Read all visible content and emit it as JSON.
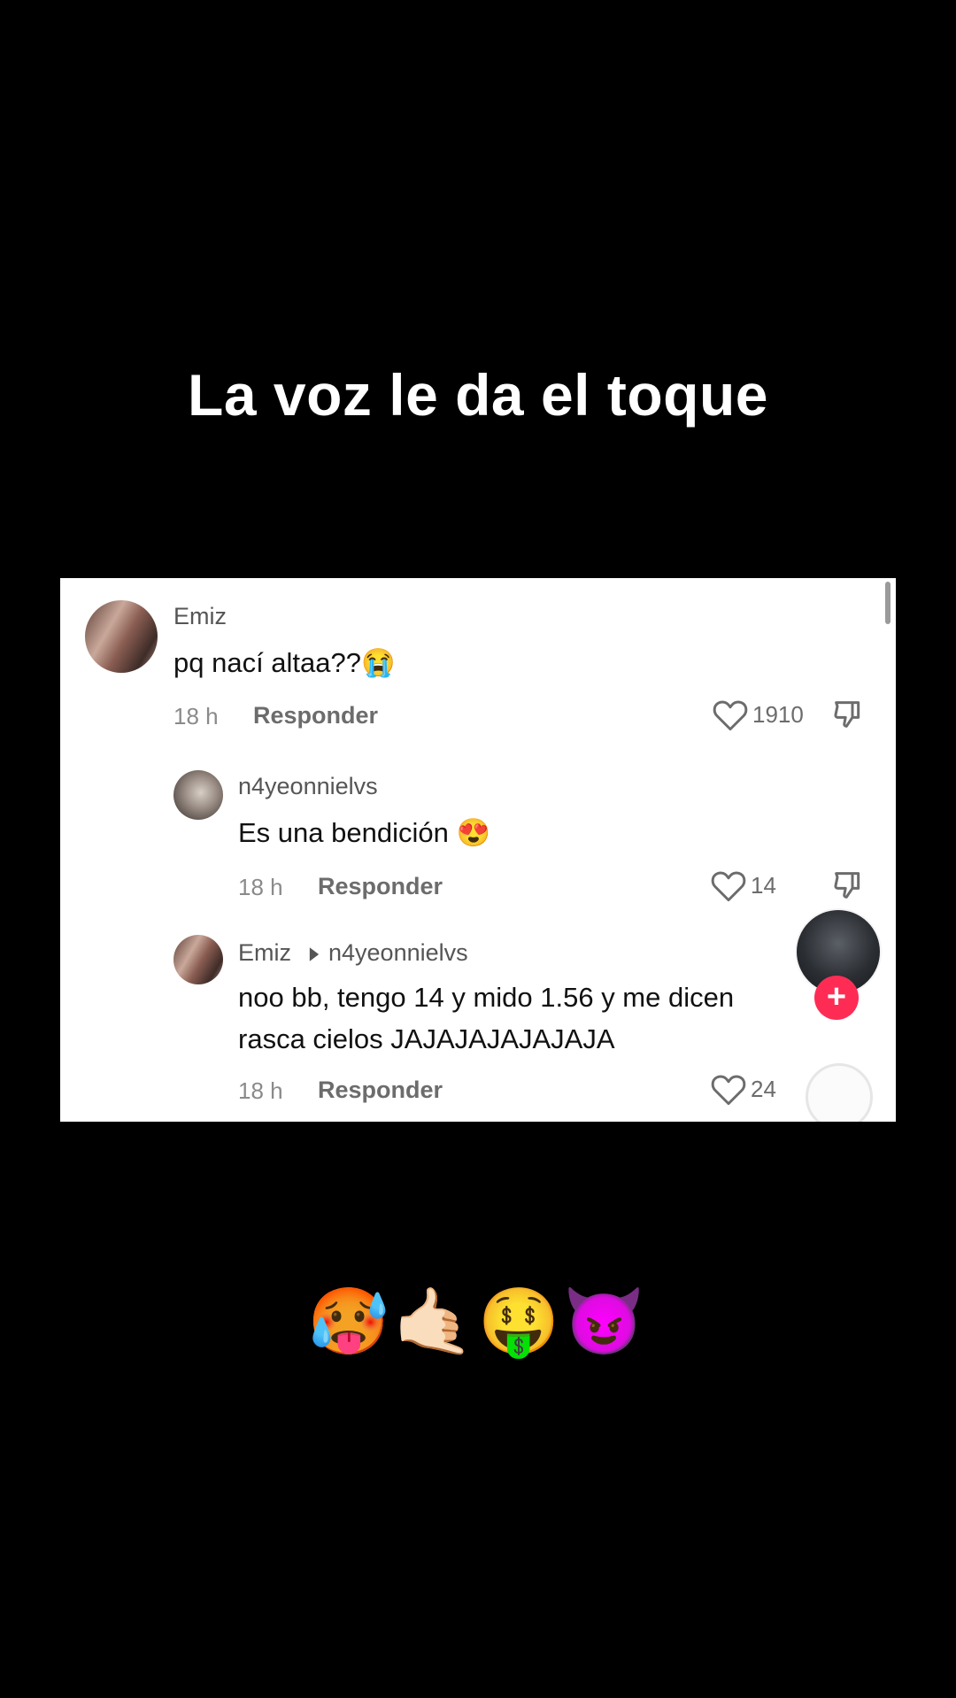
{
  "caption": {
    "top_text": "La voz le da el toque",
    "bottom_emojis": "🥵🤙🏻🤑😈"
  },
  "comments": [
    {
      "username": "Emiz",
      "text": "pq nací altaa??😭",
      "time": "18 h",
      "reply_label": "Responder",
      "likes": "1910"
    },
    {
      "username": "n4yeonnielvs",
      "text": "Es una bendición 😍",
      "time": "18 h",
      "reply_label": "Responder",
      "likes": "14"
    },
    {
      "username": "Emiz",
      "reply_to": "n4yeonnielvs",
      "text_line1": "noo bb, tengo 14 y mido 1.56 y me dicen",
      "text_line2": "rasca cielos JAJAJAJAJAJAJA",
      "time": "18 h",
      "reply_label": "Responder",
      "likes": "24"
    }
  ],
  "creator": {
    "follow_symbol": "+"
  },
  "icons": {
    "like": "heart-outline-icon",
    "dislike": "thumbs-down-icon",
    "reply_arrow": "triangle-right-icon"
  },
  "colors": {
    "background": "#000000",
    "panel": "#ffffff",
    "follow_accent": "#fe2c55"
  }
}
